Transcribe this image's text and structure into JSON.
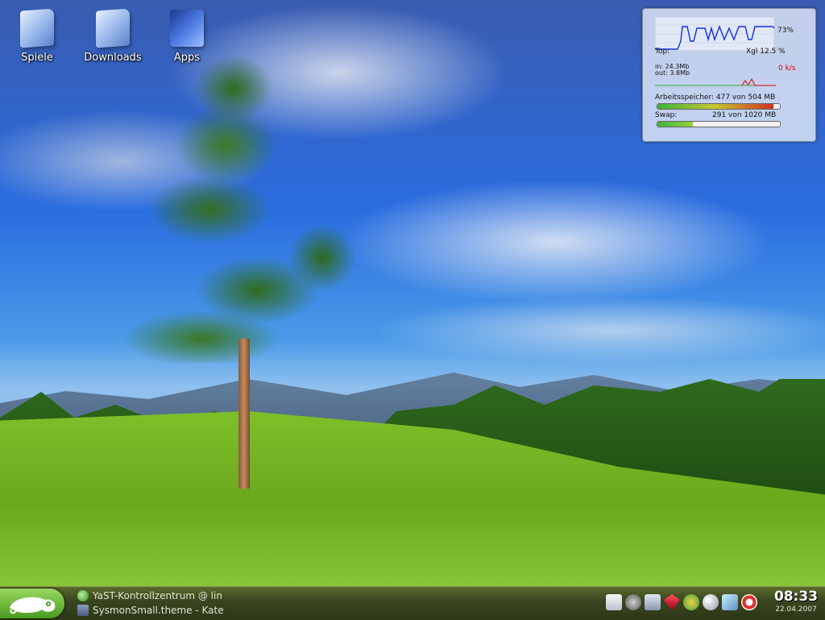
{
  "desktop": {
    "icons": [
      {
        "label": "Spiele",
        "icon": "folder-icon"
      },
      {
        "label": "Downloads",
        "icon": "folder-icon"
      },
      {
        "label": "Apps",
        "icon": "apps-icon"
      }
    ]
  },
  "sysmon": {
    "cpu_percent": "73%",
    "cpu_load": 0.73,
    "top_label": "Top:",
    "top_process": "Xgl 12.5  %",
    "net_in": "in: 24.3Mb",
    "net_out": "out: 3.8Mb",
    "net_rate": "0 k/s",
    "mem_label": "Arbeitsspeicher: 477 von 504 MB",
    "mem_fraction": 0.95,
    "swap_label": "Swap:",
    "swap_value": "291 von 1020 MB",
    "swap_fraction": 0.29
  },
  "taskbar": {
    "kmenu_icon": "opensuse-chameleon-icon",
    "tasks": [
      {
        "label": "YaST-Kontrollzentrum @ lin"
      },
      {
        "label": "SysmonSmall.theme - Kate"
      }
    ],
    "tray_icons": [
      "document-icon",
      "speaker-icon",
      "disk-icon",
      "ruby-icon",
      "update-icon",
      "globe-icon",
      "notes-icon",
      "lifebuoy-icon"
    ],
    "clock": {
      "time": "08:33",
      "date": "22.04.2007"
    }
  }
}
